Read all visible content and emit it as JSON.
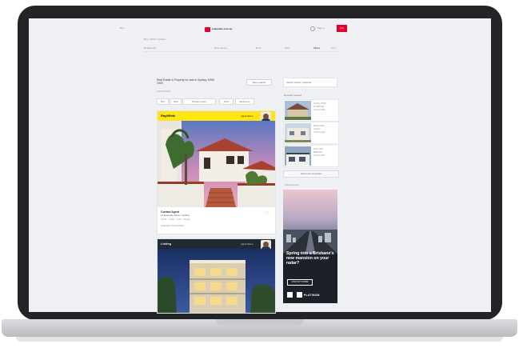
{
  "header": {
    "region_label": "Buy",
    "logo_text": "realestate.com.au",
    "signin_label": "Sign in",
    "join_label": "Join"
  },
  "breadcrumb": "Buy / NSW / Sydney",
  "nav": {
    "items": [
      {
        "label": "Residential"
      },
      {
        "label": "New homes"
      },
      {
        "label": "Rent"
      },
      {
        "label": "Sold"
      },
      {
        "label": "Filters"
      },
      {
        "label": "Sort"
      }
    ]
  },
  "results": {
    "title": "Real Estate & Property for sale in Sydney, NSW 2000",
    "save_search_label": "Save search",
    "count_text": "1,234 results",
    "filters": [
      "Buy",
      "Sold",
      "Property types",
      "Price",
      "Bedrooms"
    ]
  },
  "listings": [
    {
      "agency": "RayWhite",
      "agent_name": "Agent Name",
      "price": "Contact Agent",
      "address": "12 Example Street, Sydney",
      "features": "4 bed · 3 bath · 2 car · House",
      "inspection": "Inspection Sat 10:00am",
      "brand_color": "#ffe512"
    },
    {
      "agency": "Listing",
      "agent_name": "Agent Name",
      "brand_color": "#1f2a33"
    }
  ],
  "sidebar": {
    "search_placeholder": "Search suburb, postcode",
    "recent_title": "Recently viewed",
    "recent": [
      {
        "line1": "Sydney NSW",
        "line2": "$1,250,000",
        "line3": "3 bed 2 bath"
      },
      {
        "line1": "Bondi NSW",
        "line2": "Auction",
        "line3": "2 bed 1 bath"
      },
      {
        "line1": "Surry Hills",
        "line2": "$980,000",
        "line3": "2 bed 1 bath"
      }
    ],
    "view_more_label": "View more properties",
    "ad_label": "Advertisement",
    "ad": {
      "headline": "Spring into a Brisbane's new mansion on your radar?",
      "button_label": "FIND OUT MORE",
      "brand": "PLATINUM"
    }
  },
  "colors": {
    "accent": "#e4002b",
    "screen_bg": "#eef0f3",
    "laptop": "#232427"
  }
}
